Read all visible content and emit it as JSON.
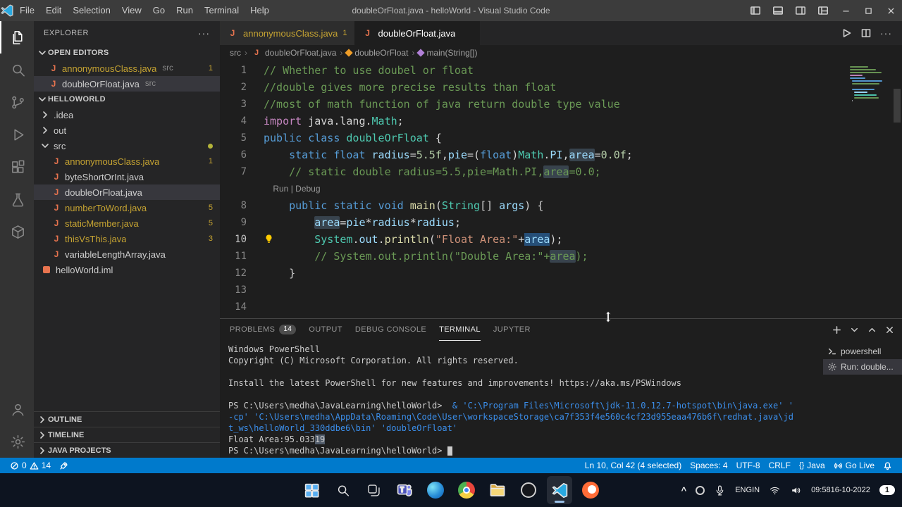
{
  "colors": {
    "accent": "#007acc",
    "selection": "#264f78",
    "warning": "#cca700",
    "java_icon": "#e8744f"
  },
  "titlebar": {
    "title": "doubleOrFloat.java - helloWorld - Visual Studio Code",
    "menus": [
      "File",
      "Edit",
      "Selection",
      "View",
      "Go",
      "Run",
      "Terminal",
      "Help"
    ],
    "window_controls": [
      {
        "name": "toggle-primary-sidebar",
        "icon": "layout-sidebar-icon"
      },
      {
        "name": "toggle-panel",
        "icon": "layout-panel-icon"
      },
      {
        "name": "toggle-secondary-sidebar",
        "icon": "layout-right-icon"
      },
      {
        "name": "customize-layout",
        "icon": "layout-grid-icon"
      },
      {
        "name": "minimize",
        "icon": "minimize-icon"
      },
      {
        "name": "maximize",
        "icon": "maximize-icon"
      },
      {
        "name": "close",
        "icon": "close-icon"
      }
    ]
  },
  "activity_bar": [
    {
      "name": "explorer",
      "icon": "files-icon",
      "active": true
    },
    {
      "name": "search",
      "icon": "search-icon"
    },
    {
      "name": "source-control",
      "icon": "source-control-icon"
    },
    {
      "name": "run-and-debug",
      "icon": "run-icon"
    },
    {
      "name": "extensions",
      "icon": "extensions-icon"
    },
    {
      "name": "testing",
      "icon": "beaker-icon"
    },
    {
      "name": "containers",
      "icon": "package-icon"
    },
    {
      "name": "accounts",
      "icon": "account-icon",
      "bottom": true
    },
    {
      "name": "settings",
      "icon": "gear-icon",
      "bottom": true
    }
  ],
  "sidebar": {
    "title": "EXPLORER",
    "open_editors": {
      "label": "OPEN EDITORS",
      "items": [
        {
          "file": "annonymousClass.java",
          "detail": "src",
          "badge": "1",
          "warn": true
        },
        {
          "file": "doubleOrFloat.java",
          "detail": "src",
          "active": true,
          "close_visible": true
        }
      ]
    },
    "tree": {
      "label": "HELLOWORLD",
      "items": [
        {
          "kind": "folder",
          "label": ".idea",
          "depth": 0,
          "expanded": false
        },
        {
          "kind": "folder",
          "label": "out",
          "depth": 0,
          "expanded": false
        },
        {
          "kind": "folder",
          "label": "src",
          "depth": 0,
          "expanded": true,
          "dot": true
        },
        {
          "kind": "java",
          "label": "annonymousClass.java",
          "depth": 1,
          "badge": "1",
          "warn": true
        },
        {
          "kind": "java",
          "label": "byteShortOrInt.java",
          "depth": 1
        },
        {
          "kind": "java",
          "label": "doubleOrFloat.java",
          "depth": 1,
          "selected": true
        },
        {
          "kind": "java",
          "label": "numberToWord.java",
          "depth": 1,
          "badge": "5",
          "warn": true
        },
        {
          "kind": "java",
          "label": "staticMember.java",
          "depth": 1,
          "badge": "5",
          "warn": true
        },
        {
          "kind": "java",
          "label": "thisVsThis.java",
          "depth": 1,
          "badge": "3",
          "warn": true
        },
        {
          "kind": "java",
          "label": "variableLengthArray.java",
          "depth": 1
        },
        {
          "kind": "iml",
          "label": "helloWorld.iml",
          "depth": 0
        }
      ]
    },
    "bottom_sections": [
      "OUTLINE",
      "TIMELINE",
      "JAVA PROJECTS"
    ]
  },
  "editor": {
    "tabs": [
      {
        "label": "annonymousClass.java",
        "badge": "1",
        "warn": true
      },
      {
        "label": "doubleOrFloat.java",
        "active": true
      }
    ],
    "actions": [
      {
        "name": "run-java",
        "icon": "play-icon"
      },
      {
        "name": "split-editor",
        "icon": "split-icon"
      },
      {
        "name": "more-actions",
        "icon": "more-glyph"
      }
    ],
    "breadcrumb": [
      {
        "label": "src"
      },
      {
        "label": "doubleOrFloat.java",
        "icon": "java"
      },
      {
        "label": "doubleOrFloat",
        "icon": "class"
      },
      {
        "label": "main(String[])",
        "icon": "method"
      }
    ],
    "codelens": {
      "run": "Run",
      "sep": " | ",
      "debug": "Debug"
    },
    "active_line": 10,
    "lines": [
      {
        "n": 1,
        "tokens": [
          {
            "t": "// Whether to use doubel or float",
            "c": "cm"
          }
        ]
      },
      {
        "n": 2,
        "tokens": [
          {
            "t": "//double gives more precise results than float",
            "c": "cm"
          }
        ]
      },
      {
        "n": 3,
        "tokens": [
          {
            "t": "//most of math function of java return double type value",
            "c": "cm"
          }
        ]
      },
      {
        "n": 4,
        "tokens": [
          {
            "t": "import",
            "c": "ctrl"
          },
          {
            "t": " java.lang.",
            "c": "pn"
          },
          {
            "t": "Math",
            "c": "type"
          },
          {
            "t": ";",
            "c": "pn"
          }
        ]
      },
      {
        "n": 5,
        "tokens": [
          {
            "t": "public",
            "c": "kw"
          },
          {
            "t": " ",
            "c": "pn"
          },
          {
            "t": "class",
            "c": "kw"
          },
          {
            "t": " ",
            "c": "pn"
          },
          {
            "t": "doubleOrFloat",
            "c": "type"
          },
          {
            "t": " {",
            "c": "pn"
          }
        ]
      },
      {
        "n": 6,
        "tokens": [
          {
            "t": "    ",
            "c": "pn"
          },
          {
            "t": "static",
            "c": "kw"
          },
          {
            "t": " ",
            "c": "pn"
          },
          {
            "t": "float",
            "c": "kw"
          },
          {
            "t": " ",
            "c": "pn"
          },
          {
            "t": "radius",
            "c": "var"
          },
          {
            "t": "=",
            "c": "pn"
          },
          {
            "t": "5.5f",
            "c": "num"
          },
          {
            "t": ",",
            "c": "pn"
          },
          {
            "t": "pie",
            "c": "var"
          },
          {
            "t": "=(",
            "c": "pn"
          },
          {
            "t": "float",
            "c": "kw"
          },
          {
            "t": ")",
            "c": "pn"
          },
          {
            "t": "Math",
            "c": "type"
          },
          {
            "t": ".",
            "c": "pn"
          },
          {
            "t": "PI",
            "c": "const"
          },
          {
            "t": ",",
            "c": "pn"
          },
          {
            "t": "area",
            "c": "var",
            "h": "occ"
          },
          {
            "t": "=",
            "c": "pn"
          },
          {
            "t": "0.0f",
            "c": "num"
          },
          {
            "t": ";",
            "c": "pn"
          }
        ]
      },
      {
        "n": 7,
        "tokens": [
          {
            "t": "    ",
            "c": "pn"
          },
          {
            "t": "// static double radius=5.5,pie=Math.PI,",
            "c": "cm"
          },
          {
            "t": "area",
            "c": "cm",
            "h": "occ"
          },
          {
            "t": "=0.0;",
            "c": "cm"
          }
        ]
      },
      {
        "lens": true
      },
      {
        "n": 8,
        "tokens": [
          {
            "t": "    ",
            "c": "pn"
          },
          {
            "t": "public",
            "c": "kw"
          },
          {
            "t": " ",
            "c": "pn"
          },
          {
            "t": "static",
            "c": "kw"
          },
          {
            "t": " ",
            "c": "pn"
          },
          {
            "t": "void",
            "c": "kw"
          },
          {
            "t": " ",
            "c": "pn"
          },
          {
            "t": "main",
            "c": "fn"
          },
          {
            "t": "(",
            "c": "pn"
          },
          {
            "t": "String",
            "c": "type"
          },
          {
            "t": "[] ",
            "c": "pn"
          },
          {
            "t": "args",
            "c": "var"
          },
          {
            "t": ") {",
            "c": "pn"
          }
        ]
      },
      {
        "n": 9,
        "tokens": [
          {
            "t": "        ",
            "c": "pn"
          },
          {
            "t": "area",
            "c": "var",
            "h": "occ"
          },
          {
            "t": "=",
            "c": "pn"
          },
          {
            "t": "pie",
            "c": "var"
          },
          {
            "t": "*",
            "c": "pn"
          },
          {
            "t": "radius",
            "c": "var"
          },
          {
            "t": "*",
            "c": "pn"
          },
          {
            "t": "radius",
            "c": "var"
          },
          {
            "t": ";",
            "c": "pn"
          }
        ]
      },
      {
        "n": 10,
        "bulb": true,
        "tokens": [
          {
            "t": "        ",
            "c": "pn"
          },
          {
            "t": "System",
            "c": "type"
          },
          {
            "t": ".",
            "c": "pn"
          },
          {
            "t": "out",
            "c": "var"
          },
          {
            "t": ".",
            "c": "pn"
          },
          {
            "t": "println",
            "c": "fn"
          },
          {
            "t": "(",
            "c": "pn"
          },
          {
            "t": "\"Float Area:\"",
            "c": "str"
          },
          {
            "t": "+",
            "c": "pn"
          },
          {
            "t": "area",
            "c": "var",
            "h": "sel"
          },
          {
            "t": ");",
            "c": "pn"
          }
        ]
      },
      {
        "n": 11,
        "tokens": [
          {
            "t": "        ",
            "c": "pn"
          },
          {
            "t": "// System.out.println(\"Double Area:\"+",
            "c": "cm"
          },
          {
            "t": "area",
            "c": "cm",
            "h": "occ"
          },
          {
            "t": ");",
            "c": "cm"
          }
        ]
      },
      {
        "n": 12,
        "tokens": [
          {
            "t": "    }",
            "c": "pn"
          }
        ]
      },
      {
        "n": 13,
        "tokens": []
      },
      {
        "n": 14,
        "tokens": []
      }
    ]
  },
  "panel": {
    "tabs": [
      {
        "label": "PROBLEMS",
        "badge": "14"
      },
      {
        "label": "OUTPUT"
      },
      {
        "label": "DEBUG CONSOLE"
      },
      {
        "label": "TERMINAL",
        "active": true
      },
      {
        "label": "JUPYTER"
      }
    ],
    "actions": [
      {
        "name": "new-terminal",
        "icon": "plus-icon"
      },
      {
        "name": "terminal-picker",
        "icon": "chevron-down-icon"
      },
      {
        "name": "maximize-panel",
        "icon": "chevron-up-icon"
      },
      {
        "name": "close-panel",
        "icon": "close-icon"
      }
    ],
    "terminal": {
      "lines": [
        [
          {
            "t": "Windows PowerShell"
          }
        ],
        [
          {
            "t": "Copyright (C) Microsoft Corporation. All rights reserved."
          }
        ],
        [],
        [
          {
            "t": "Install the latest PowerShell for new features and improvements! https://aka.ms/PSWindows"
          }
        ],
        [],
        [
          {
            "t": "PS C:\\Users\\medha\\JavaLearning\\helloWorld>  "
          },
          {
            "t": "& 'C:\\Program Files\\Microsoft\\jdk-11.0.12.7-hotspot\\bin\\java.exe' '",
            "c": "b"
          }
        ],
        [
          {
            "t": "-cp' 'C:\\Users\\medha\\AppData\\Roaming\\Code\\User\\workspaceStorage\\ca7f353f4e560c4cf23d955eaa476b6f\\redhat.java\\jd",
            "c": "b"
          }
        ],
        [
          {
            "t": "t_ws\\helloWorld_330ddbe6\\bin' 'doubleOrFloat'",
            "c": "b"
          }
        ],
        [
          {
            "t": "Float Area:95.033"
          },
          {
            "t": "19",
            "hl": true
          }
        ],
        [
          {
            "t": "PS C:\\Users\\medha\\JavaLearning\\helloWorld> "
          },
          {
            "cursor": true
          }
        ]
      ],
      "list": [
        {
          "label": "powershell",
          "icon": "terminal-icon"
        },
        {
          "label": "Run: double...",
          "icon": "gear-icon",
          "selected": true
        }
      ]
    }
  },
  "status_bar": {
    "errors": "0",
    "warnings": "14",
    "right": [
      {
        "name": "cursor-position",
        "label": "Ln 10, Col 42 (4 selected)"
      },
      {
        "name": "indentation",
        "label": "Spaces: 4"
      },
      {
        "name": "encoding",
        "label": "UTF-8"
      },
      {
        "name": "eol",
        "label": "CRLF"
      },
      {
        "name": "language-mode",
        "label": "Java",
        "glyph": "{}"
      },
      {
        "name": "go-live",
        "label": "Go Live",
        "icon": "broadcast-icon"
      },
      {
        "name": "notifications",
        "label": "",
        "icon": "bell-icon"
      }
    ]
  },
  "taskbar": {
    "apps": [
      {
        "name": "start"
      },
      {
        "name": "search"
      },
      {
        "name": "task-view"
      },
      {
        "name": "teams"
      },
      {
        "name": "edge"
      },
      {
        "name": "chrome"
      },
      {
        "name": "file-explorer"
      },
      {
        "name": "dell"
      },
      {
        "name": "vscode",
        "active": true
      },
      {
        "name": "postman"
      }
    ],
    "tray": {
      "expand_glyph": "^",
      "lang_top": "ENG",
      "lang_bottom": "IN",
      "time": "09:58",
      "date": "16-10-2022",
      "notification_badge": "1"
    }
  },
  "glyphs": {
    "java_file": "J",
    "more": "···"
  }
}
